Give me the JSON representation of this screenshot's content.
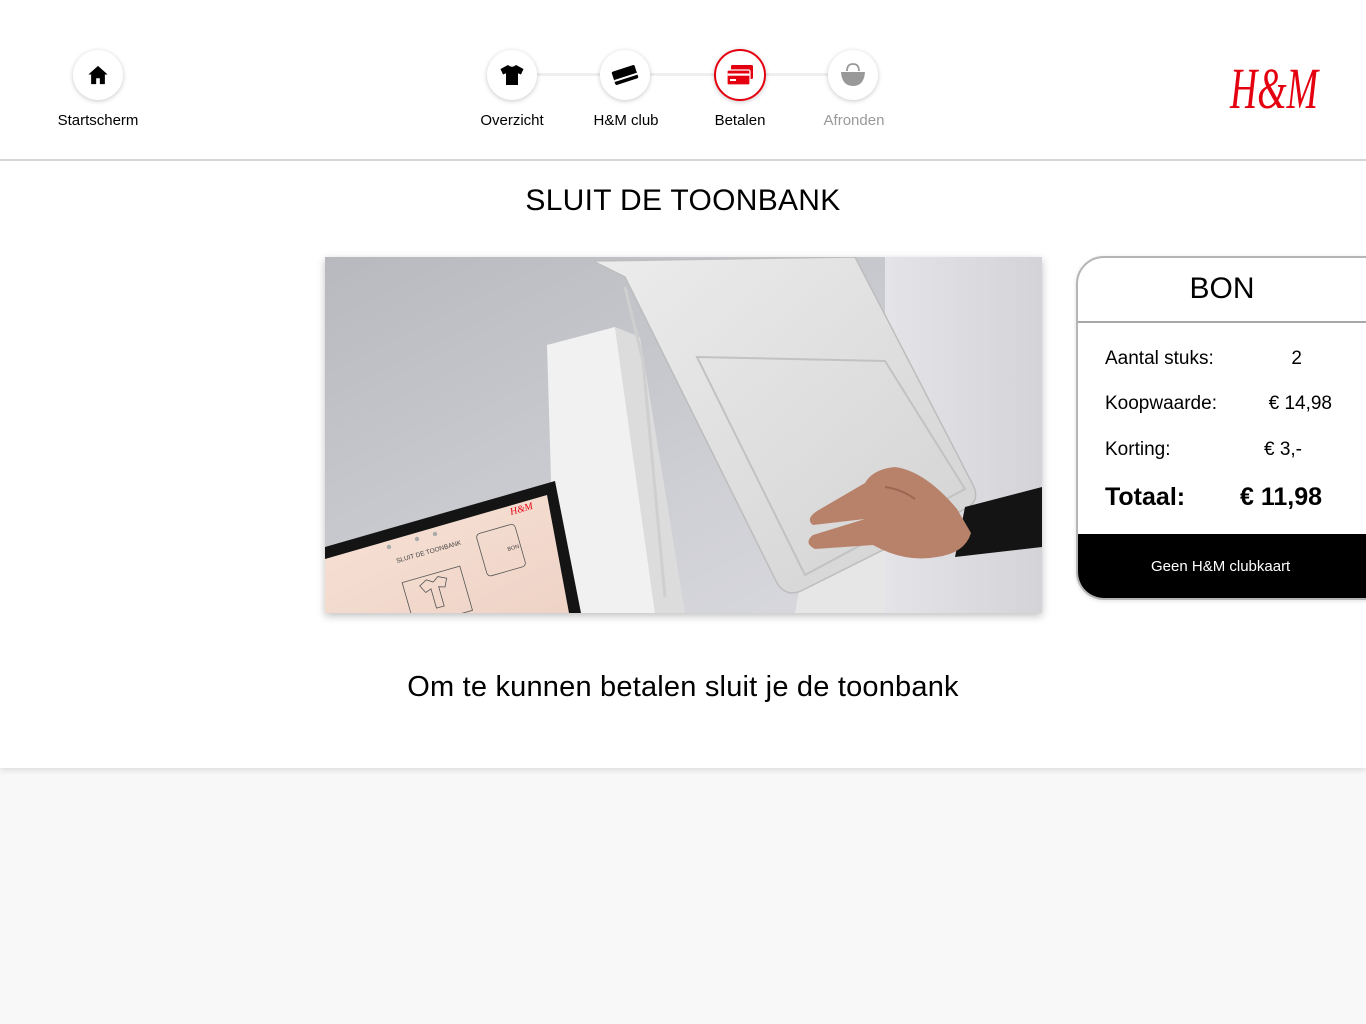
{
  "nav": {
    "home": {
      "label": "Startscherm",
      "icon": "home-icon"
    },
    "steps": [
      {
        "label": "Overzicht",
        "icon": "tshirt-icon",
        "state": "done"
      },
      {
        "label": "H&M club",
        "icon": "membership-card-icon",
        "state": "done"
      },
      {
        "label": "Betalen",
        "icon": "credit-card-icon",
        "state": "active"
      },
      {
        "label": "Afronden",
        "icon": "shopping-bag-icon",
        "state": "upcoming"
      }
    ],
    "logo_text": "H&M"
  },
  "main": {
    "title": "SLUIT DE TOONBANK",
    "subtitle": "Om te kunnen betalen sluit je de toonbank",
    "video": {
      "screen_logo": "H&M",
      "screen_title": "SLUIT DE TOONBANK",
      "screen_receipt_title": "BON"
    }
  },
  "receipt": {
    "title": "BON",
    "rows": [
      {
        "label": "Aantal stuks:",
        "value": "2"
      },
      {
        "label": "Koopwaarde:",
        "value": "€ 14,98"
      },
      {
        "label": "Korting:",
        "value": "€ 3,-"
      }
    ],
    "total": {
      "label": "Totaal:",
      "value": "€ 11,98"
    },
    "footer_button": "Geen H&M clubkaart"
  },
  "colors": {
    "accent": "#e50010",
    "footer_bg": "#000000",
    "page_bg": "#f8f8f8"
  }
}
